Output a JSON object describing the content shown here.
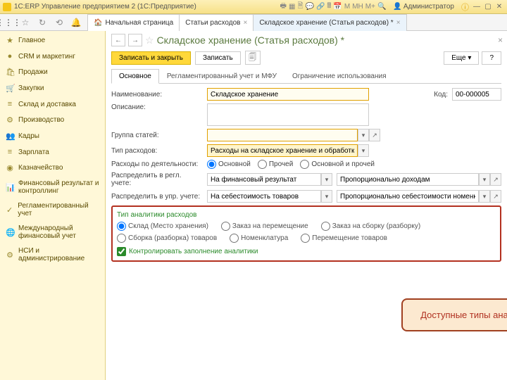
{
  "titlebar": {
    "app_title": "1С:ERP Управление предприятием 2 (1С:Предприятие)",
    "user_label": "Администратор",
    "m1": "М",
    "m2": "МН",
    "m3": "М+"
  },
  "top_tabs": {
    "home": "Начальная страница",
    "t1": "Статьи расходов",
    "t2": "Складское хранение (Статья расходов) *"
  },
  "sidebar": [
    {
      "icon": "★",
      "label": "Главное"
    },
    {
      "icon": "●",
      "label": "CRM и маркетинг"
    },
    {
      "icon": "🛍",
      "label": "Продажи"
    },
    {
      "icon": "🛒",
      "label": "Закупки"
    },
    {
      "icon": "≡",
      "label": "Склад и доставка"
    },
    {
      "icon": "⚙",
      "label": "Производство"
    },
    {
      "icon": "👥",
      "label": "Кадры"
    },
    {
      "icon": "≡",
      "label": "Зарплата"
    },
    {
      "icon": "◉",
      "label": "Казначейство"
    },
    {
      "icon": "📊",
      "label": "Финансовый результат и\nконтроллинг"
    },
    {
      "icon": "✓",
      "label": "Регламентированный учет"
    },
    {
      "icon": "🌐",
      "label": "Международный\nфинансовый учет"
    },
    {
      "icon": "⚙",
      "label": "НСИ и\nадминистрирование"
    }
  ],
  "page": {
    "title": "Складское хранение (Статья расходов) *",
    "btn_save_close": "Записать и закрыть",
    "btn_save": "Записать",
    "btn_more": "Еще",
    "help": "?"
  },
  "inner_tabs": {
    "t1": "Основное",
    "t2": "Регламентированный учет и МФУ",
    "t3": "Ограничение использования"
  },
  "form": {
    "name_label": "Наименование:",
    "name_value": "Складское хранение",
    "code_label": "Код:",
    "code_value": "00-000005",
    "desc_label": "Описание:",
    "group_label": "Группа статей:",
    "type_label": "Тип расходов:",
    "type_value": "Расходы на складское хранение и обработку",
    "activity_label": "Расходы по деятельности:",
    "activity_opts": {
      "o1": "Основной",
      "o2": "Прочей",
      "o3": "Основной и прочей"
    },
    "regl_label": "Распределить в регл. учете:",
    "regl_v1": "На финансовый результат",
    "regl_v2": "Пропорционально доходам",
    "upr_label": "Распределить в упр. учете:",
    "upr_v1": "На себестоимость товаров",
    "upr_v2": "Пропорционально себестоимости номенклатуры"
  },
  "analytics": {
    "title": "Тип аналитики расходов",
    "o1": "Склад (Место хранения)",
    "o2": "Заказ на перемещение",
    "o3": "Заказ на сборку (разборку)",
    "o4": "Сборка (разборка) товаров",
    "o5": "Номенклатура",
    "o6": "Перемещение товаров",
    "check": "Контролировать заполнение аналитики"
  },
  "callout": "Доступные типы аналитики"
}
